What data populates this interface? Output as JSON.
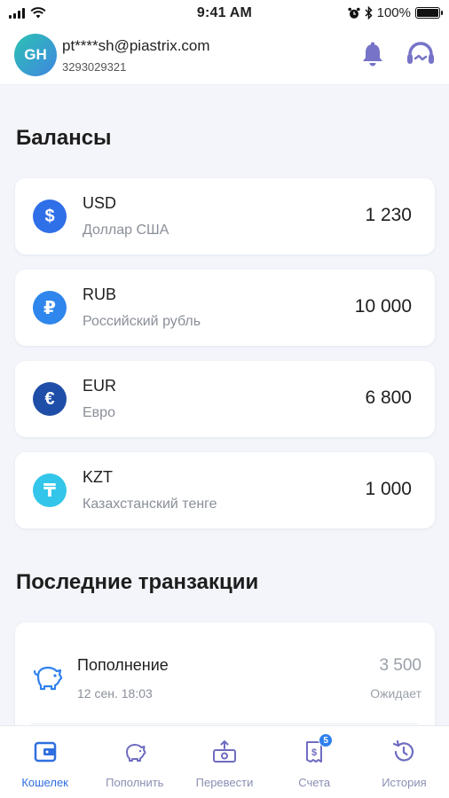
{
  "status_bar": {
    "time": "9:41 AM",
    "battery": "100%"
  },
  "header": {
    "avatar_initials": "GH",
    "email": "pt****sh@piastrix.com",
    "account_id": "3293029321",
    "icons": [
      "bell-icon",
      "support-headset-icon"
    ]
  },
  "balances": {
    "title": "Балансы",
    "items": [
      {
        "code": "USD",
        "name": "Доллар США",
        "amount": "1 230",
        "symbol": "$",
        "color": "#2f6fe8"
      },
      {
        "code": "RUB",
        "name": "Российский рубль",
        "amount": "10 000",
        "symbol": "₽",
        "color": "#2f86ec"
      },
      {
        "code": "EUR",
        "name": "Евро",
        "amount": "6 800",
        "symbol": "€",
        "color": "#1f4ea8"
      },
      {
        "code": "KZT",
        "name": "Казахстанский тенге",
        "amount": "1 000",
        "symbol": "₸",
        "color": "#33c6ea"
      }
    ]
  },
  "transactions": {
    "title": "Последние транзакции",
    "items": [
      {
        "title": "Пополнение",
        "date": "12 сен. 18:03",
        "amount": "3 500",
        "status": "Ожидает",
        "icon": "piggy-bank-icon"
      }
    ]
  },
  "bottom_nav": {
    "items": [
      {
        "label": "Кошелек",
        "icon": "wallet-icon",
        "active": true
      },
      {
        "label": "Пополнить",
        "icon": "piggy-bank-icon",
        "active": false
      },
      {
        "label": "Перевести",
        "icon": "transfer-icon",
        "active": false
      },
      {
        "label": "Счета",
        "icon": "invoice-icon",
        "active": false,
        "badge": "5"
      },
      {
        "label": "История",
        "icon": "history-icon",
        "active": false
      }
    ]
  },
  "colors": {
    "accent": "#2f6fe0",
    "nav_inactive": "#8a8fb2",
    "icon_purple": "#6f6cc0"
  }
}
